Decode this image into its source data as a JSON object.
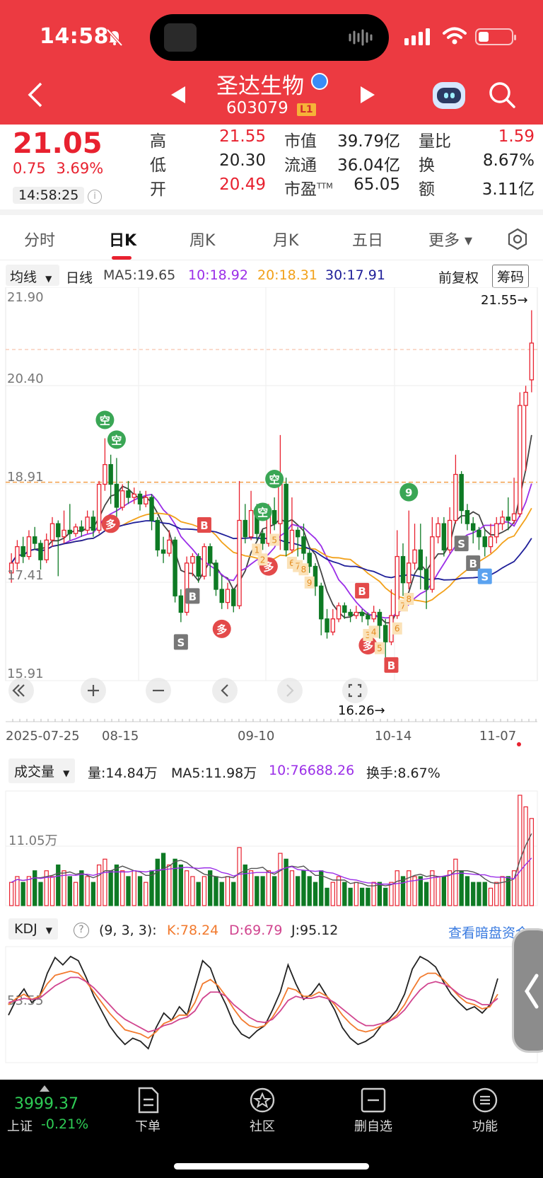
{
  "status_bar": {
    "time": "14:58"
  },
  "header": {
    "stock_name": "圣达生物",
    "stock_code": "603079",
    "level_badge": "L1"
  },
  "quote": {
    "price": "21.05",
    "change": "0.75",
    "change_pct": "3.69%",
    "time": "14:58:25",
    "rows": [
      [
        {
          "label": "高",
          "value": "21.55",
          "color": "red"
        },
        {
          "label": "市值",
          "value": "39.79亿",
          "color": "dark"
        },
        {
          "label": "量比",
          "value": "1.59",
          "color": "red"
        }
      ],
      [
        {
          "label": "低",
          "value": "20.30",
          "color": "dark"
        },
        {
          "label": "流通",
          "value": "36.04亿",
          "color": "dark"
        },
        {
          "label": "换",
          "value": "8.67%",
          "color": "dark"
        }
      ],
      [
        {
          "label": "开",
          "value": "20.49",
          "color": "red"
        },
        {
          "label": "市盈",
          "sup": "TTM",
          "value": "65.05",
          "color": "dark"
        },
        {
          "label": "额",
          "value": "3.11亿",
          "color": "dark"
        }
      ]
    ]
  },
  "tabs": [
    "分时",
    "日K",
    "周K",
    "月K",
    "五日",
    "更多"
  ],
  "active_tab": "日K",
  "ma_bar": {
    "dropdown": "均线",
    "period": "日线",
    "ma5": "MA5:19.65",
    "ma10": "10:18.92",
    "ma20": "20:18.31",
    "ma30": "30:17.91",
    "adjust": "前复权",
    "chips": "筹码"
  },
  "colors": {
    "up": "#e8212f",
    "down": "#0e7a24",
    "ma5": "#444444",
    "ma10": "#9b2ee8",
    "ma20": "#f2a11a",
    "ma30": "#1f1f99",
    "kdj_k": "#f27a2e",
    "kdj_d": "#d1458f",
    "kdj_j": "#222222"
  },
  "chart_data": {
    "type": "candlestick",
    "y_ticks": [
      "21.90",
      "20.40",
      "18.91",
      "17.41",
      "15.91"
    ],
    "ylim": [
      15.91,
      21.9
    ],
    "x_labels": [
      "2025-07-25",
      "08-15",
      "09-10",
      "10-14",
      "11-07"
    ],
    "high_marker": "21.55→",
    "low_marker": "16.26→",
    "reference_price": 18.91,
    "candles": [
      [
        17.55,
        17.7,
        17.4,
        17.85
      ],
      [
        17.7,
        17.95,
        17.6,
        18.05
      ],
      [
        17.95,
        17.8,
        17.7,
        18.1
      ],
      [
        17.8,
        18.1,
        17.75,
        18.2
      ],
      [
        18.1,
        18.0,
        17.9,
        18.25
      ],
      [
        18.0,
        17.75,
        17.6,
        18.05
      ],
      [
        17.75,
        18.05,
        17.7,
        18.15
      ],
      [
        18.05,
        18.3,
        17.95,
        18.4
      ],
      [
        18.3,
        18.1,
        17.5,
        18.35
      ],
      [
        18.1,
        18.2,
        18.0,
        18.5
      ],
      [
        18.2,
        18.15,
        18.05,
        18.6
      ],
      [
        18.15,
        18.25,
        18.1,
        18.3
      ],
      [
        18.25,
        18.2,
        18.1,
        18.35
      ],
      [
        18.2,
        18.4,
        18.15,
        18.5
      ],
      [
        18.4,
        18.2,
        18.1,
        18.5
      ],
      [
        18.2,
        18.9,
        18.15,
        18.95
      ],
      [
        18.9,
        19.2,
        18.8,
        19.6
      ],
      [
        19.2,
        18.9,
        18.6,
        19.35
      ],
      [
        18.9,
        18.55,
        18.4,
        19.3
      ],
      [
        18.55,
        18.8,
        18.5,
        18.9
      ],
      [
        18.8,
        18.7,
        18.6,
        18.95
      ],
      [
        18.7,
        18.75,
        18.6,
        18.85
      ],
      [
        18.75,
        18.6,
        18.5,
        18.8
      ],
      [
        18.6,
        18.7,
        18.55,
        18.8
      ],
      [
        18.7,
        18.35,
        18.2,
        18.75
      ],
      [
        18.35,
        17.9,
        17.8,
        18.4
      ],
      [
        17.9,
        17.85,
        17.7,
        18.1
      ],
      [
        17.85,
        18.05,
        17.8,
        18.2
      ],
      [
        18.05,
        17.2,
        17.1,
        18.1
      ],
      [
        17.2,
        16.95,
        16.8,
        17.3
      ],
      [
        16.95,
        17.7,
        16.9,
        17.8
      ],
      [
        17.7,
        17.8,
        17.5,
        17.85
      ],
      [
        17.8,
        17.5,
        17.4,
        17.85
      ],
      [
        17.5,
        17.95,
        17.45,
        18.0
      ],
      [
        17.95,
        17.7,
        17.5,
        18.0
      ],
      [
        17.7,
        17.3,
        17.2,
        17.75
      ],
      [
        17.3,
        17.1,
        17.0,
        17.5
      ],
      [
        17.1,
        17.3,
        17.0,
        17.4
      ],
      [
        17.3,
        17.05,
        16.95,
        17.3
      ],
      [
        17.05,
        18.35,
        17.0,
        18.95
      ],
      [
        18.35,
        18.1,
        18.0,
        18.6
      ],
      [
        18.1,
        18.5,
        18.05,
        18.8
      ],
      [
        18.5,
        18.15,
        18.05,
        18.6
      ],
      [
        18.15,
        18.0,
        17.9,
        18.2
      ],
      [
        18.0,
        18.5,
        17.95,
        18.6
      ],
      [
        18.5,
        18.3,
        18.2,
        18.7
      ],
      [
        18.3,
        18.9,
        17.9,
        19.65
      ],
      [
        18.9,
        17.9,
        17.8,
        19.0
      ],
      [
        17.9,
        18.2,
        17.85,
        18.7
      ],
      [
        18.2,
        18.1,
        17.8,
        18.25
      ],
      [
        18.1,
        17.85,
        17.75,
        18.3
      ],
      [
        17.85,
        17.65,
        17.55,
        17.9
      ],
      [
        17.65,
        17.35,
        17.2,
        17.7
      ],
      [
        17.35,
        16.85,
        16.6,
        17.4
      ],
      [
        16.85,
        16.65,
        16.55,
        17.0
      ],
      [
        16.65,
        16.85,
        16.6,
        17.0
      ],
      [
        16.85,
        17.05,
        16.8,
        17.1
      ],
      [
        17.05,
        16.95,
        16.85,
        17.1
      ],
      [
        16.95,
        16.9,
        16.8,
        17.0
      ],
      [
        16.9,
        16.95,
        16.85,
        17.05
      ],
      [
        16.95,
        16.9,
        16.8,
        17.0
      ],
      [
        16.9,
        16.85,
        16.75,
        16.95
      ],
      [
        16.85,
        16.95,
        16.8,
        17.05
      ],
      [
        16.95,
        16.75,
        16.55,
        17.0
      ],
      [
        16.75,
        16.5,
        16.26,
        16.85
      ],
      [
        16.5,
        16.9,
        16.45,
        17.3
      ],
      [
        16.9,
        17.8,
        16.85,
        18.2
      ],
      [
        17.8,
        17.4,
        17.2,
        18.0
      ],
      [
        17.4,
        17.7,
        17.3,
        18.5
      ],
      [
        17.7,
        17.9,
        17.6,
        18.3
      ],
      [
        17.9,
        17.6,
        17.3,
        18.3
      ],
      [
        17.6,
        17.3,
        17.0,
        17.8
      ],
      [
        17.3,
        18.1,
        17.25,
        18.4
      ],
      [
        18.1,
        18.3,
        18.0,
        18.4
      ],
      [
        18.3,
        17.9,
        17.8,
        18.4
      ],
      [
        17.9,
        18.35,
        17.85,
        18.55
      ],
      [
        18.35,
        19.05,
        18.3,
        19.35
      ],
      [
        19.05,
        18.5,
        18.3,
        19.1
      ],
      [
        18.5,
        18.3,
        18.2,
        18.6
      ],
      [
        18.3,
        18.2,
        18.0,
        18.4
      ],
      [
        18.2,
        18.1,
        17.9,
        18.25
      ],
      [
        18.1,
        17.95,
        17.8,
        18.2
      ],
      [
        17.95,
        18.1,
        17.85,
        18.3
      ],
      [
        18.1,
        18.3,
        18.0,
        18.4
      ],
      [
        18.3,
        18.4,
        18.2,
        18.5
      ],
      [
        18.4,
        18.35,
        18.2,
        18.7
      ],
      [
        18.35,
        18.45,
        18.3,
        19.0
      ],
      [
        18.45,
        20.1,
        18.4,
        20.3
      ],
      [
        20.1,
        20.3,
        19.1,
        20.4
      ],
      [
        20.49,
        21.05,
        20.3,
        21.55
      ]
    ],
    "signals": [
      {
        "i": 16,
        "text": "空",
        "kind": "green",
        "pos": "above"
      },
      {
        "i": 18,
        "text": "空",
        "kind": "green",
        "pos": "above"
      },
      {
        "i": 17,
        "text": "多",
        "kind": "red",
        "pos": "below"
      },
      {
        "i": 29,
        "text": "S",
        "kind": "gray",
        "pos": "below"
      },
      {
        "i": 31,
        "text": "B",
        "kind": "gray",
        "pos": "below"
      },
      {
        "i": 33,
        "text": "B",
        "kind": "red",
        "pos": "above"
      },
      {
        "i": 36,
        "text": "多",
        "kind": "red",
        "pos": "below"
      },
      {
        "i": 43,
        "text": "空",
        "kind": "green",
        "pos": "above"
      },
      {
        "i": 45,
        "text": "空",
        "kind": "green",
        "pos": "above"
      },
      {
        "i": 44,
        "text": "多",
        "kind": "red",
        "pos": "below"
      },
      {
        "i": 60,
        "text": "B",
        "kind": "red",
        "pos": "above"
      },
      {
        "i": 61,
        "text": "多",
        "kind": "red",
        "pos": "below"
      },
      {
        "i": 65,
        "text": "B",
        "kind": "red",
        "pos": "below"
      },
      {
        "i": 68,
        "text": "9",
        "kind": "green",
        "pos": "above"
      },
      {
        "i": 77,
        "text": "S",
        "kind": "gray",
        "pos": "below"
      },
      {
        "i": 79,
        "text": "B",
        "kind": "gray",
        "pos": "below"
      },
      {
        "i": 81,
        "text": "S",
        "kind": "blue",
        "pos": "below"
      }
    ],
    "counts": [
      {
        "i": 42,
        "text": "1"
      },
      {
        "i": 43,
        "text": "2"
      },
      {
        "i": 45,
        "text": "5"
      },
      {
        "i": 48,
        "text": "6"
      },
      {
        "i": 49,
        "text": "7"
      },
      {
        "i": 50,
        "text": "8"
      },
      {
        "i": 51,
        "text": "9"
      },
      {
        "i": 61,
        "text": "3"
      },
      {
        "i": 62,
        "text": "4"
      },
      {
        "i": 63,
        "text": "5"
      },
      {
        "i": 66,
        "text": "6"
      },
      {
        "i": 67,
        "text": "7"
      },
      {
        "i": 68,
        "text": "8"
      }
    ]
  },
  "volume": {
    "dropdown": "成交量",
    "amount": "量:14.84万",
    "ma5": "MA5:11.98万",
    "ma10": "10:76688.26",
    "turnover": "换手:8.67%",
    "y_tick": "11.05万",
    "values": [
      4,
      5,
      4,
      5,
      6,
      4,
      6,
      5,
      7,
      6,
      5,
      4,
      6,
      5,
      4,
      7,
      8,
      6,
      7,
      6,
      5,
      6,
      5,
      4,
      6,
      8,
      9,
      7,
      8,
      7,
      6,
      5,
      4,
      5,
      6,
      5,
      4,
      5,
      4,
      10,
      7,
      6,
      5,
      5,
      6,
      5,
      9,
      8,
      6,
      5,
      6,
      5,
      4,
      6,
      3,
      4,
      5,
      4,
      3,
      4,
      3,
      3,
      4,
      4,
      3,
      4,
      6,
      5,
      6,
      5,
      5,
      4,
      6,
      5,
      5,
      6,
      8,
      6,
      5,
      4,
      4,
      4,
      3,
      4,
      5,
      5,
      6,
      19,
      17,
      15
    ]
  },
  "kdj": {
    "dropdown": "KDJ",
    "params": "(9, 3, 3):",
    "k": "K:78.24",
    "d": "D:69.79",
    "j": "J:95.12",
    "link": "查看暗盘资金",
    "y_tick": "53.55",
    "j_values": [
      40,
      55,
      65,
      52,
      58,
      80,
      95,
      88,
      96,
      92,
      76,
      58,
      44,
      30,
      20,
      12,
      18,
      15,
      8,
      28,
      42,
      35,
      48,
      40,
      66,
      92,
      85,
      65,
      50,
      32,
      22,
      18,
      25,
      30,
      45,
      62,
      88,
      70,
      55,
      60,
      70,
      58,
      45,
      28,
      18,
      12,
      15,
      20,
      30,
      36,
      45,
      60,
      84,
      96,
      92,
      86,
      72,
      60,
      52,
      45,
      48,
      42,
      50,
      75
    ],
    "k_values": [
      50,
      56,
      60,
      55,
      58,
      70,
      78,
      80,
      82,
      80,
      72,
      62,
      52,
      42,
      34,
      26,
      24,
      22,
      18,
      24,
      32,
      35,
      40,
      40,
      52,
      70,
      74,
      68,
      58,
      46,
      36,
      30,
      28,
      30,
      38,
      50,
      66,
      64,
      58,
      58,
      62,
      58,
      50,
      40,
      32,
      26,
      24,
      26,
      30,
      34,
      40,
      50,
      64,
      76,
      80,
      80,
      74,
      66,
      58,
      52,
      50,
      46,
      48,
      60
    ],
    "d_values": [
      52,
      54,
      56,
      55,
      56,
      62,
      68,
      72,
      76,
      76,
      72,
      66,
      58,
      50,
      42,
      36,
      32,
      28,
      24,
      26,
      30,
      32,
      36,
      38,
      44,
      56,
      62,
      62,
      58,
      50,
      44,
      38,
      34,
      33,
      36,
      44,
      54,
      58,
      56,
      56,
      58,
      56,
      52,
      46,
      40,
      34,
      30,
      30,
      32,
      34,
      38,
      45,
      55,
      64,
      70,
      72,
      70,
      66,
      60,
      56,
      54,
      50,
      50,
      56
    ]
  },
  "bottom_nav": {
    "index_value": "3999.37",
    "index_name": "上证",
    "index_change": "-0.21%",
    "items": [
      {
        "label": "下单",
        "icon": "order-icon"
      },
      {
        "label": "社区",
        "icon": "community-icon"
      },
      {
        "label": "删自选",
        "icon": "remove-watchlist-icon"
      },
      {
        "label": "功能",
        "icon": "menu-icon"
      }
    ]
  }
}
